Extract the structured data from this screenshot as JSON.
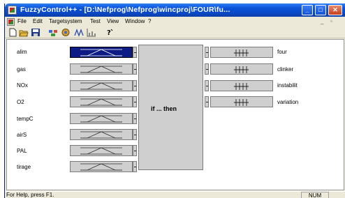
{
  "window": {
    "title": "FuzzyControl++ - [D:\\Nefprog\\Nefprog\\wincproj\\FOUR\\fu..."
  },
  "menu": {
    "items": [
      "File",
      "Edit",
      "Targetsystem",
      "Test",
      "View",
      "Window",
      "?"
    ]
  },
  "toolbar": {
    "icons": [
      "new-icon",
      "open-icon",
      "save-icon",
      "rule-base-icon",
      "fuzzy-set-icon",
      "edit-set-icon",
      "chart-icon",
      "help-icon"
    ]
  },
  "inputs": [
    {
      "label": "alim",
      "selected": true
    },
    {
      "label": "gas",
      "selected": false
    },
    {
      "label": "NOx",
      "selected": false
    },
    {
      "label": "O2",
      "selected": false
    },
    {
      "label": "tempC",
      "selected": false
    },
    {
      "label": "airS",
      "selected": false
    },
    {
      "label": "PAL",
      "selected": false
    },
    {
      "label": "tirage",
      "selected": false
    }
  ],
  "rule_block": {
    "label": "if ... then"
  },
  "outputs": [
    {
      "label": "four"
    },
    {
      "label": "clinker"
    },
    {
      "label": "instabilit"
    },
    {
      "label": "variation"
    }
  ],
  "status": {
    "help_text": "For Help, press F1.",
    "num": "NUM"
  },
  "colors": {
    "titlebar": "#0b54d8",
    "selected_input": "#0c1c84",
    "panel": "#cfcfcf"
  }
}
